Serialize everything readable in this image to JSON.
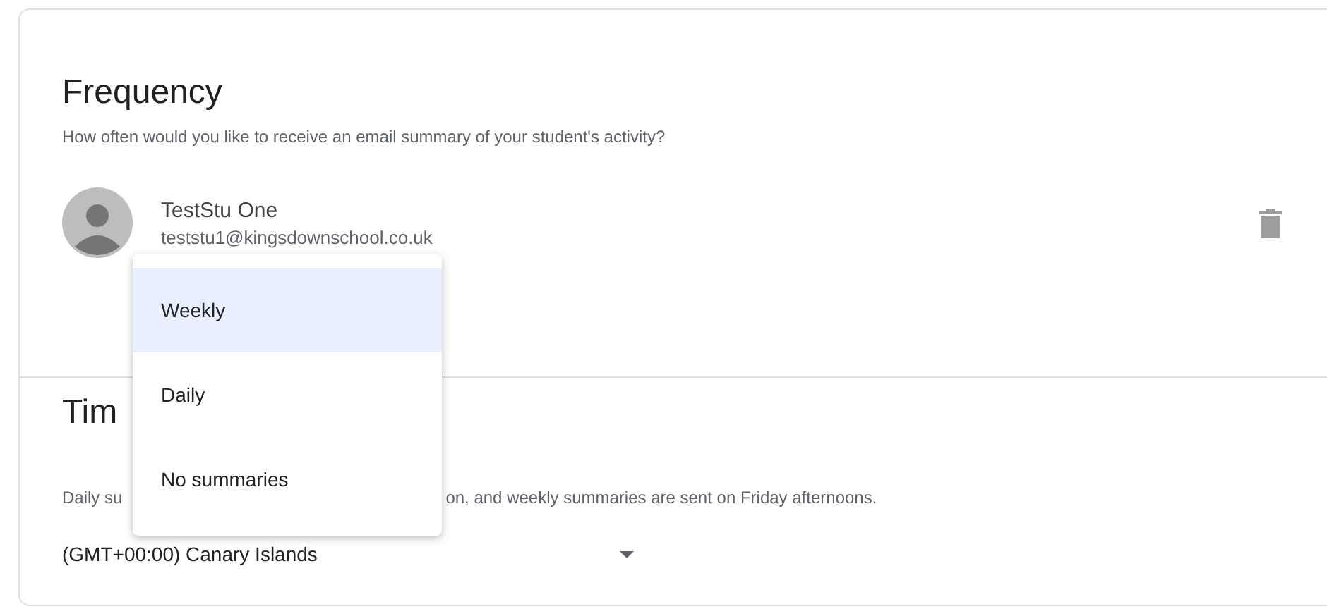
{
  "frequency": {
    "title": "Frequency",
    "description": "How often would you like to receive an email summary of your student's activity?",
    "students": [
      {
        "name": "TestStu One",
        "email": "teststu1@kingsdownschool.co.uk"
      }
    ]
  },
  "menu": {
    "options": [
      {
        "label": "Weekly",
        "selected": true
      },
      {
        "label": "Daily",
        "selected": false
      },
      {
        "label": "No summaries",
        "selected": false
      }
    ]
  },
  "timezone": {
    "title": "Tim",
    "description_parts": [
      "Daily su",
      "on, and weekly summaries are sent on Friday afternoons."
    ],
    "value": "(GMT+00:00) Canary Islands"
  }
}
